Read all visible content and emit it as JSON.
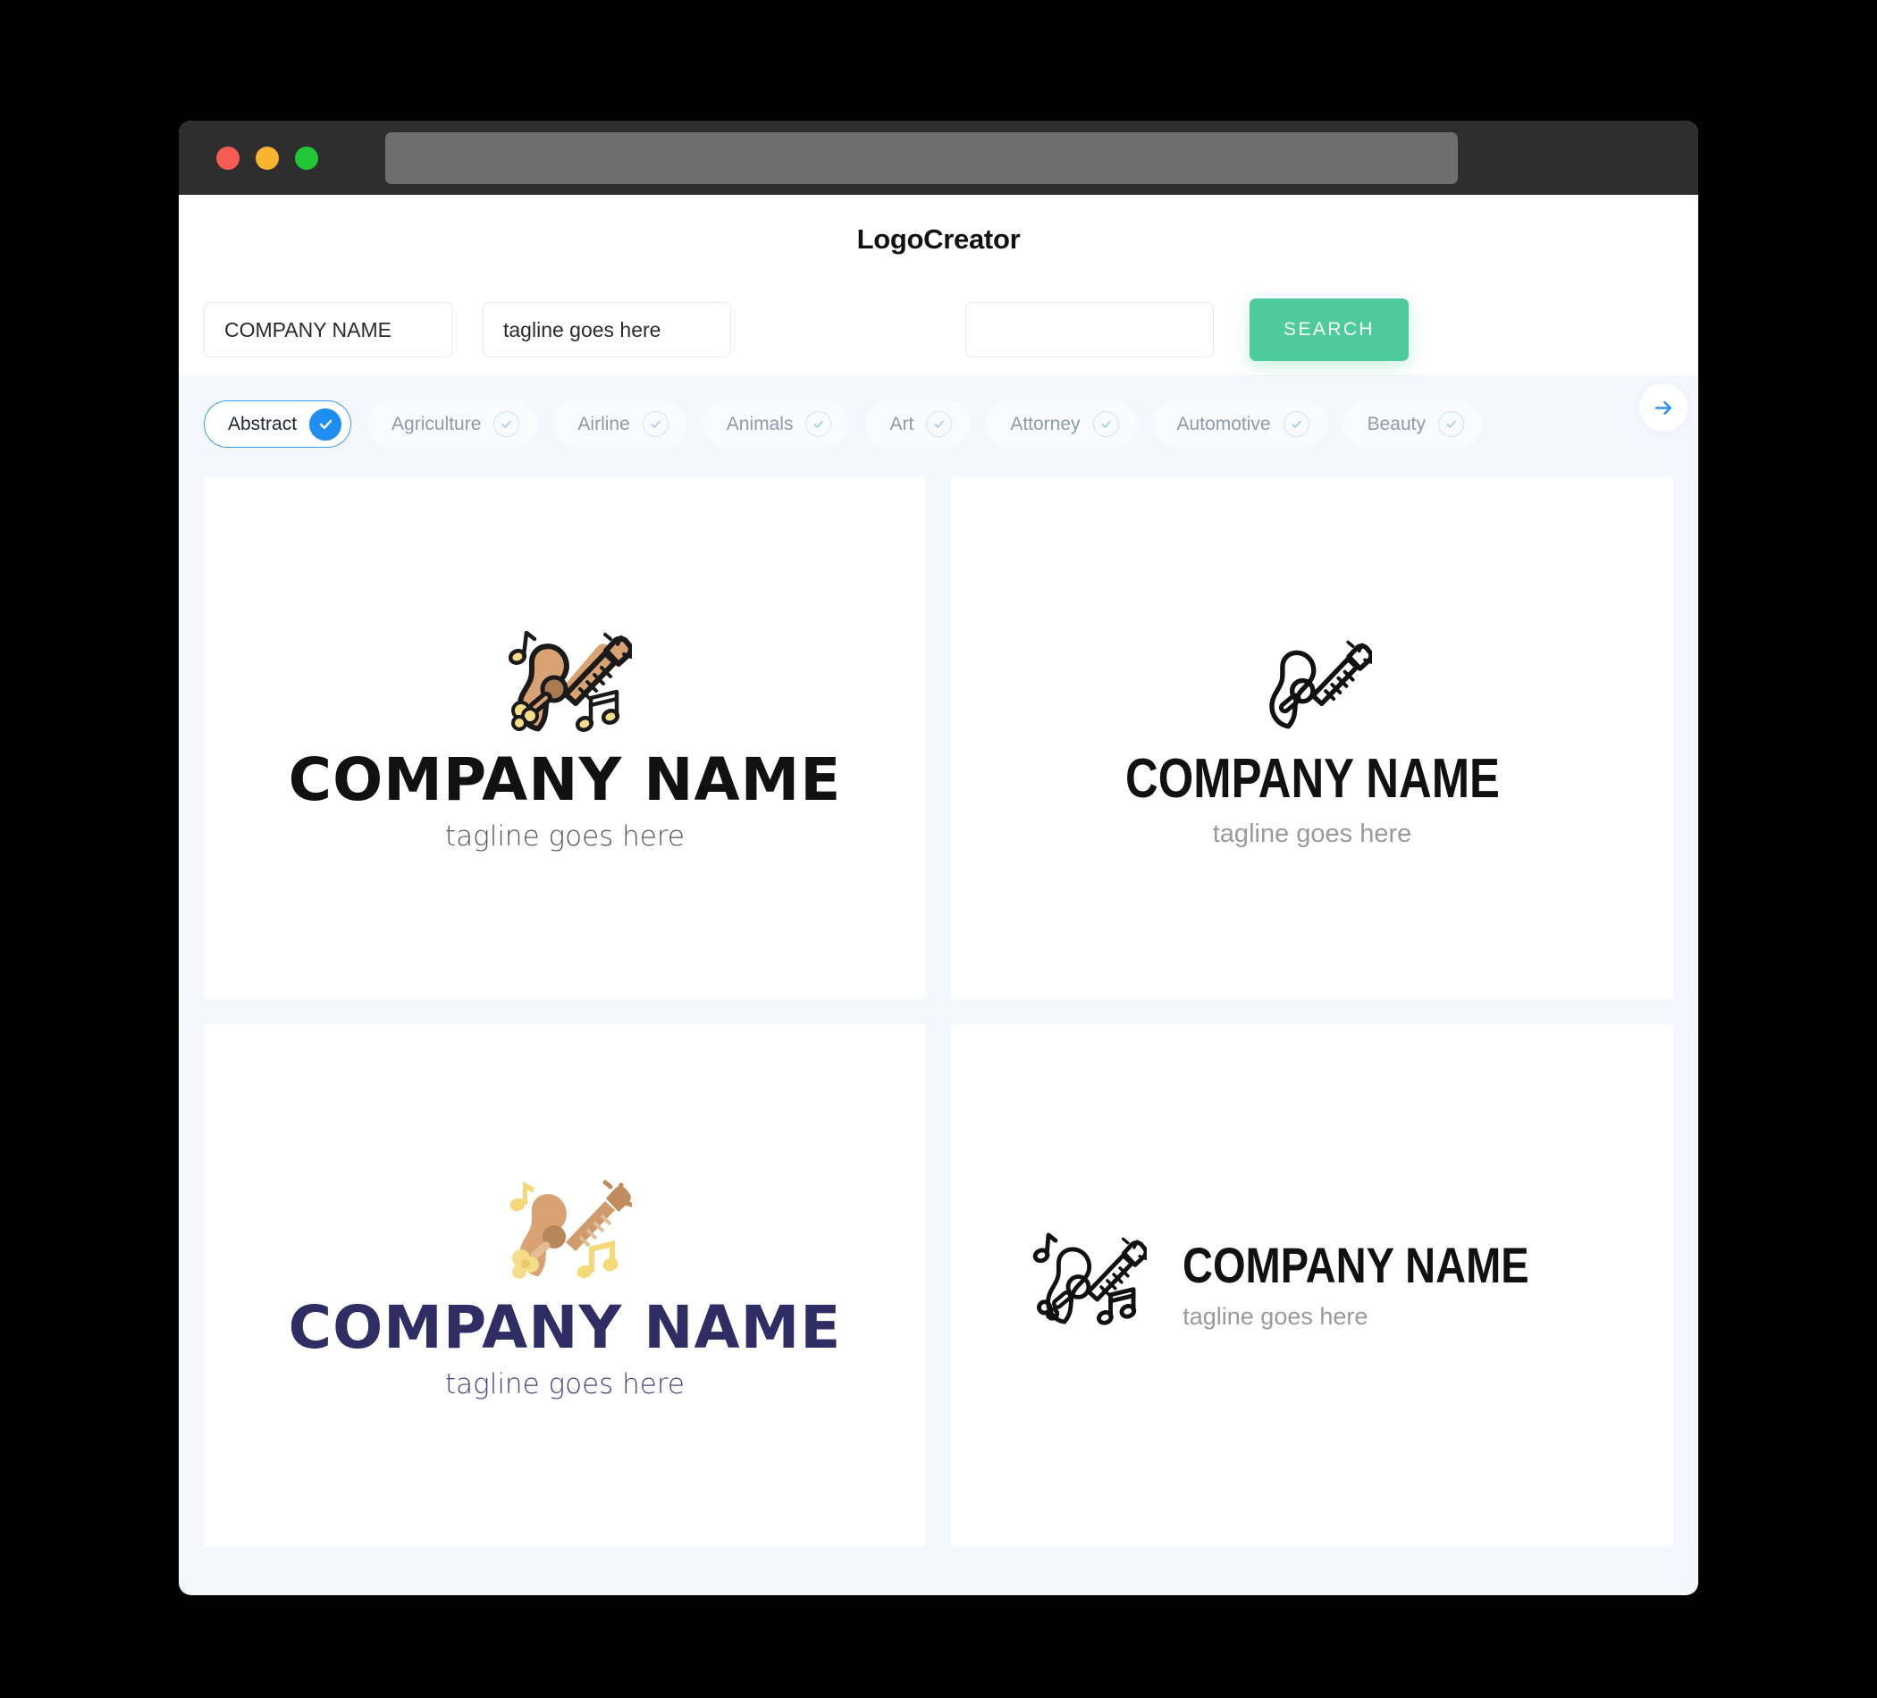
{
  "window": {
    "traffic_lights": [
      "close",
      "minimize",
      "maximize"
    ],
    "url_value": ""
  },
  "header": {
    "brand_title": "LogoCreator"
  },
  "search": {
    "company_value": "COMPANY NAME",
    "company_placeholder": "COMPANY NAME",
    "tagline_value": "tagline goes here",
    "tagline_placeholder": "tagline goes here",
    "keyword_value": "",
    "keyword_placeholder": "",
    "search_button_label": "SEARCH"
  },
  "categories": {
    "next_icon": "arrow-right-icon",
    "items": [
      {
        "label": "Abstract",
        "selected": true
      },
      {
        "label": "Agriculture",
        "selected": false
      },
      {
        "label": "Airline",
        "selected": false
      },
      {
        "label": "Animals",
        "selected": false
      },
      {
        "label": "Art",
        "selected": false
      },
      {
        "label": "Attorney",
        "selected": false
      },
      {
        "label": "Automotive",
        "selected": false
      },
      {
        "label": "Beauty",
        "selected": false
      }
    ]
  },
  "results": [
    {
      "id": "logo-1",
      "layout": "stacked",
      "icon": "guitar-color-outline-icon",
      "name": "COMPANY NAME",
      "tagline": "tagline goes here",
      "name_color": "#111111",
      "tagline_color": "#555555"
    },
    {
      "id": "logo-2",
      "layout": "stacked",
      "icon": "guitar-lineart-icon",
      "name": "COMPANY NAME",
      "tagline": "tagline goes here",
      "name_color": "#111111",
      "tagline_color": "#9a9a9a"
    },
    {
      "id": "logo-3",
      "layout": "stacked",
      "icon": "guitar-flat-icon",
      "name": "COMPANY NAME",
      "tagline": "tagline goes here",
      "name_color": "#2f2d64",
      "tagline_color": "#454386"
    },
    {
      "id": "logo-4",
      "layout": "horizontal",
      "icon": "guitar-lineart-notes-icon",
      "name": "COMPANY NAME",
      "tagline": "tagline goes here",
      "name_color": "#111111",
      "tagline_color": "#9a9a9a"
    }
  ],
  "colors": {
    "accent_green": "#4ecb9d",
    "accent_blue": "#1f8ef1",
    "page_bg": "#f4f7fe",
    "chrome_bg": "#2e2e2e",
    "guitar_body": "#d9a273",
    "guitar_note": "#f5dd8a",
    "navy": "#2f2d64"
  }
}
